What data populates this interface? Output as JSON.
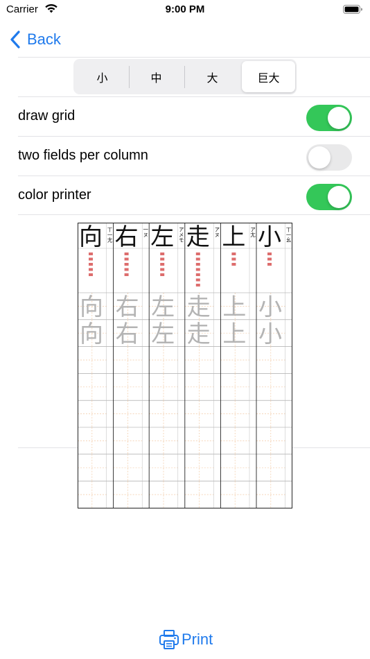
{
  "status": {
    "carrier": "Carrier",
    "time": "9:00 PM"
  },
  "nav": {
    "back_label": "Back"
  },
  "segments": [
    {
      "label": "小",
      "selected": false
    },
    {
      "label": "中",
      "selected": false
    },
    {
      "label": "大",
      "selected": false
    },
    {
      "label": "巨大",
      "selected": true
    }
  ],
  "settings": [
    {
      "label": "draw grid",
      "on": true
    },
    {
      "label": "two fields per column",
      "on": false
    },
    {
      "label": "color printer",
      "on": true
    }
  ],
  "sheet": {
    "columns": [
      {
        "char": "向",
        "reading": "丅一尢"
      },
      {
        "char": "右",
        "reading": "一ヌ"
      },
      {
        "char": "左",
        "reading": "アメモ"
      },
      {
        "char": "走",
        "reading": "アヌ"
      },
      {
        "char": "上",
        "reading": "ア尢"
      },
      {
        "char": "小",
        "reading": "丅一幺"
      }
    ],
    "colors": {
      "ink": "#111111",
      "trace": "#b4b4b4",
      "stroke_order": "#d23c3c",
      "grid": "#f2c9a4"
    }
  },
  "toolbar": {
    "print_label": "Print"
  },
  "colors": {
    "accent": "#1f7aec",
    "switch_on": "#34c759",
    "switch_off": "#e9e9ea"
  }
}
